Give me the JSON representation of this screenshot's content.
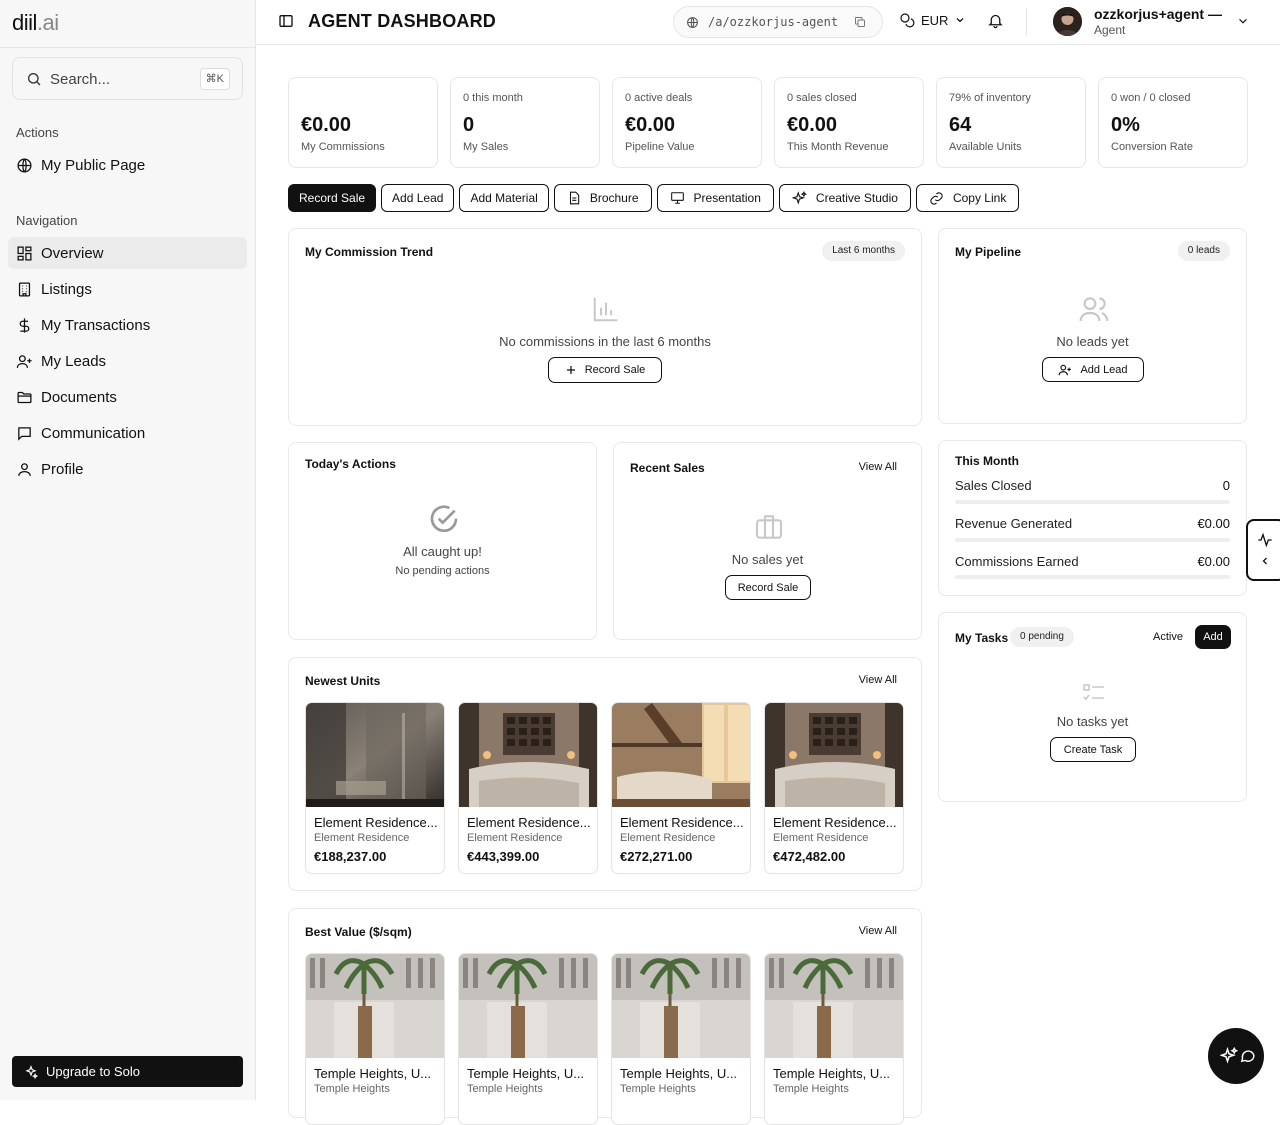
{
  "brand": {
    "logo_main": "diil",
    "logo_suffix": ".ai"
  },
  "sidebar": {
    "search_placeholder": "Search...",
    "search_shortcut": "⌘K",
    "actions_label": "Actions",
    "actions": [
      {
        "label": "My Public Page",
        "icon": "globe-icon"
      }
    ],
    "navigation_label": "Navigation",
    "nav": [
      {
        "label": "Overview",
        "icon": "grid-icon",
        "active": true
      },
      {
        "label": "Listings",
        "icon": "building-icon"
      },
      {
        "label": "My Transactions",
        "icon": "dollar-icon"
      },
      {
        "label": "My Leads",
        "icon": "user-plus-icon"
      },
      {
        "label": "Documents",
        "icon": "folder-icon"
      },
      {
        "label": "Communication",
        "icon": "message-icon"
      },
      {
        "label": "Profile",
        "icon": "user-icon"
      }
    ],
    "upgrade_label": "Upgrade to Solo"
  },
  "header": {
    "title": "AGENT DASHBOARD",
    "url": "/a/ozzkorjus-agent",
    "currency": "EUR",
    "user_name": "ozzkorjus+agent —",
    "user_role": "Agent"
  },
  "stats": [
    {
      "sub": "",
      "value": "€0.00",
      "label": "My Commissions"
    },
    {
      "sub": "0 this month",
      "value": "0",
      "label": "My Sales"
    },
    {
      "sub": "0 active deals",
      "value": "€0.00",
      "label": "Pipeline Value"
    },
    {
      "sub": "0 sales closed",
      "value": "€0.00",
      "label": "This Month Revenue"
    },
    {
      "sub": "79% of inventory",
      "value": "64",
      "label": "Available Units"
    },
    {
      "sub": "0 won / 0 closed",
      "value": "0%",
      "label": "Conversion Rate"
    }
  ],
  "quick_actions": {
    "record_sale": "Record Sale",
    "add_lead": "Add Lead",
    "add_material": "Add Material",
    "brochure": "Brochure",
    "presentation": "Presentation",
    "creative_studio": "Creative Studio",
    "copy_link": "Copy Link"
  },
  "commission_trend": {
    "title": "My Commission Trend",
    "range": "Last 6 months",
    "empty": "No commissions in the last 6 months",
    "button": "Record Sale"
  },
  "pipeline": {
    "title": "My Pipeline",
    "badge": "0 leads",
    "empty": "No leads yet",
    "button": "Add Lead"
  },
  "todays_actions": {
    "title": "Today's Actions",
    "empty": "All caught up!",
    "sub": "No pending actions"
  },
  "recent_sales": {
    "title": "Recent Sales",
    "view_all": "View All",
    "empty": "No sales yet",
    "button": "Record Sale"
  },
  "this_month": {
    "title": "This Month",
    "rows": [
      {
        "label": "Sales Closed",
        "value": "0"
      },
      {
        "label": "Revenue Generated",
        "value": "€0.00"
      },
      {
        "label": "Commissions Earned",
        "value": "€0.00"
      }
    ]
  },
  "tasks": {
    "title": "My Tasks",
    "badge": "0 pending",
    "filter": "Active",
    "add": "Add",
    "empty": "No tasks yet",
    "button": "Create Task"
  },
  "newest_units": {
    "title": "Newest Units",
    "view_all": "View All",
    "items": [
      {
        "name": "Element Residence...",
        "project": "Element Residence",
        "price": "€188,237.00"
      },
      {
        "name": "Element Residence...",
        "project": "Element Residence",
        "price": "€443,399.00"
      },
      {
        "name": "Element Residence...",
        "project": "Element Residence",
        "price": "€272,271.00"
      },
      {
        "name": "Element Residence...",
        "project": "Element Residence",
        "price": "€472,482.00"
      }
    ]
  },
  "best_value": {
    "title": "Best Value ($/sqm)",
    "view_all": "View All",
    "items": [
      {
        "name": "Temple Heights, U...",
        "project": "Temple Heights"
      },
      {
        "name": "Temple Heights, U...",
        "project": "Temple Heights"
      },
      {
        "name": "Temple Heights, U...",
        "project": "Temple Heights"
      },
      {
        "name": "Temple Heights, U...",
        "project": "Temple Heights"
      }
    ]
  }
}
